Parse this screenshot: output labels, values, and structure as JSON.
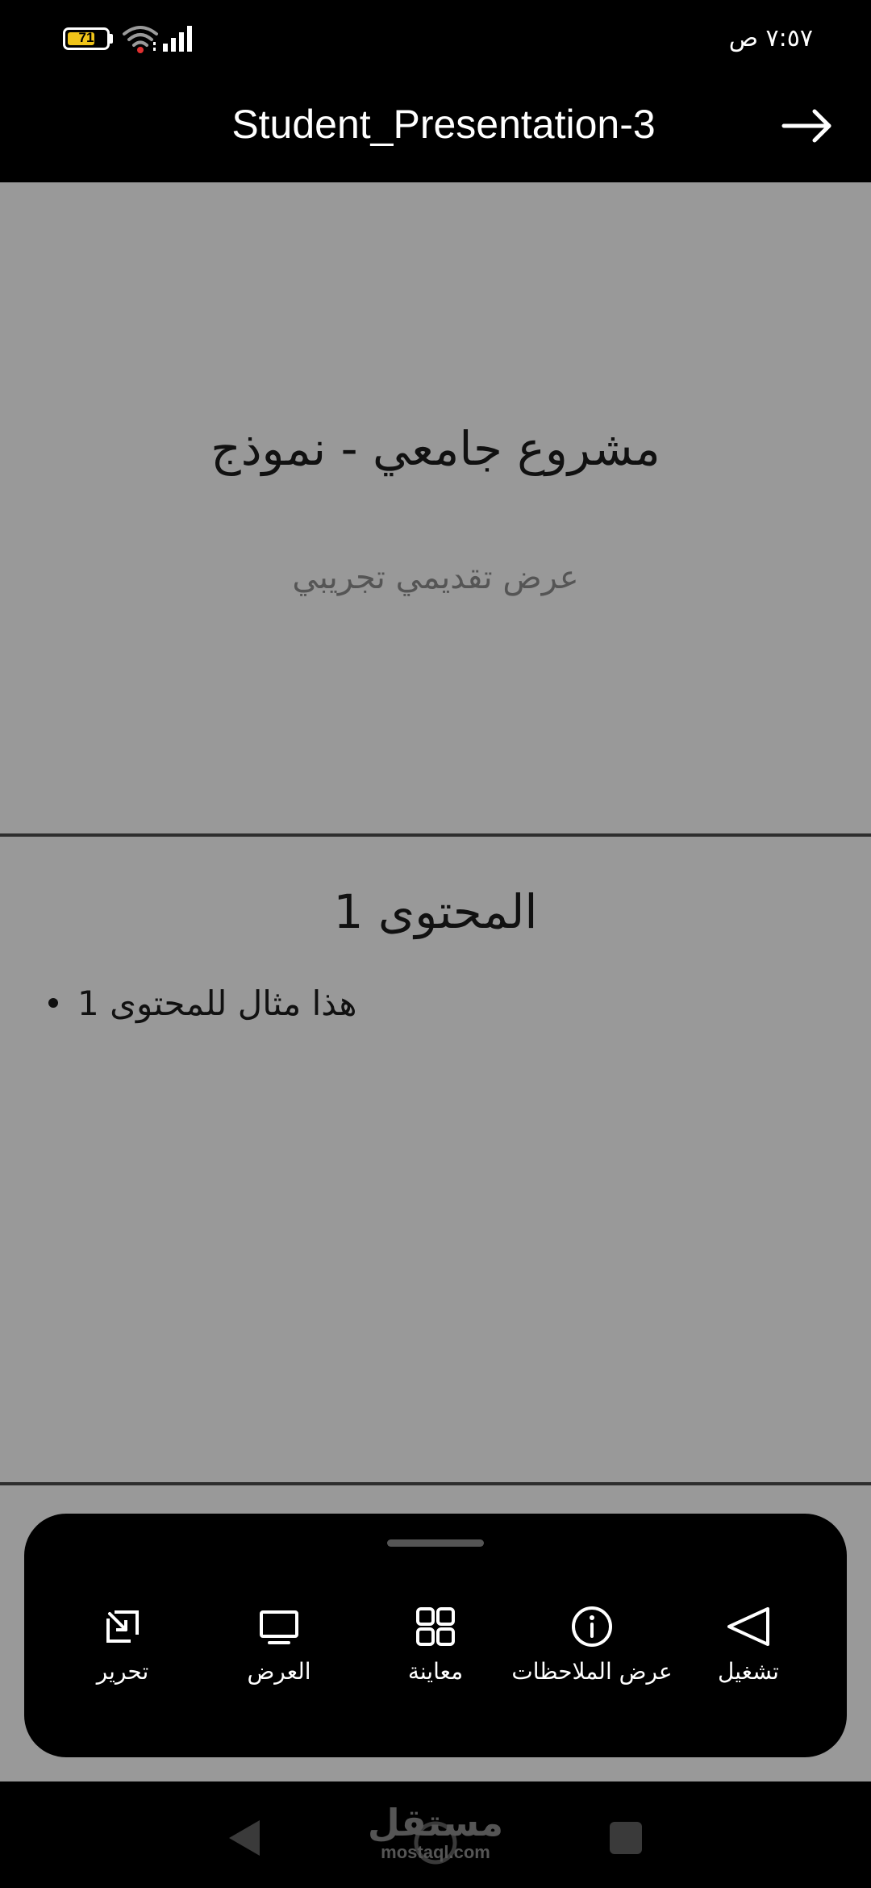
{
  "status_bar": {
    "time": "٧:٥٧ ص",
    "battery_level": "71",
    "battery_color": "#f0c419"
  },
  "header": {
    "title": "Student_Presentation-3",
    "forward_icon": "arrow-right-icon"
  },
  "slides": [
    {
      "title": "مشروع جامعي - نموذج",
      "subtitle": "عرض تقديمي تجريبي"
    },
    {
      "title": "المحتوى 1",
      "bullets": [
        "هذا مثال للمحتوى 1"
      ]
    }
  ],
  "bottom_sheet": {
    "actions": [
      {
        "label": "تحرير",
        "icon": "edit-icon"
      },
      {
        "label": "العرض",
        "icon": "monitor-icon"
      },
      {
        "label": "معاينة",
        "icon": "grid-icon"
      },
      {
        "label": "عرض الملاحظات",
        "icon": "info-icon"
      },
      {
        "label": "تشغيل",
        "icon": "play-icon"
      }
    ]
  },
  "watermark": {
    "main": "مستقل",
    "sub": "mostaql.com"
  },
  "colors": {
    "slide_background": "#999999",
    "chrome_background": "#000000",
    "slide_divider": "#2e2e2e"
  }
}
